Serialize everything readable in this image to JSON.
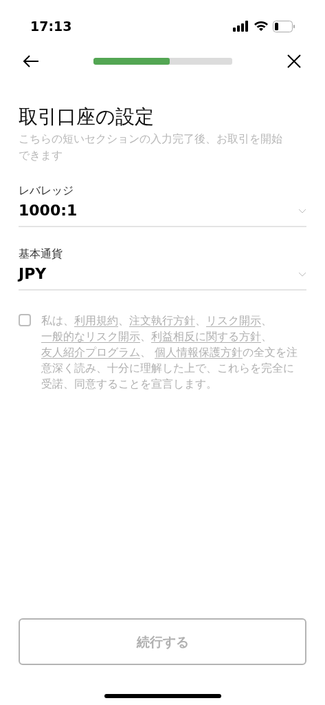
{
  "status_bar": {
    "time": "17:13"
  },
  "progress": {
    "level": 0.55
  },
  "title": "取引口座の設定",
  "subtitle": "こちらの短いセクションの入力完了後、お取引を開始できます",
  "fields": [
    {
      "label": "レバレッジ",
      "value": "1000:1"
    },
    {
      "label": "基本通貨",
      "value": "JPY"
    }
  ],
  "consent": {
    "checked": false,
    "parts": [
      {
        "text": "私は、",
        "link": false
      },
      {
        "text": "利用規約",
        "link": true
      },
      {
        "text": "、",
        "link": false
      },
      {
        "text": "注文執行方針",
        "link": true
      },
      {
        "text": "、",
        "link": false
      },
      {
        "text": "リスク開示",
        "link": true
      },
      {
        "text": "、",
        "link": false
      },
      {
        "text": "一般的なリスク開示",
        "link": true
      },
      {
        "text": "、",
        "link": false
      },
      {
        "text": "利益相反に関する方針",
        "link": true
      },
      {
        "text": "、",
        "link": false
      },
      {
        "text": "友人紹介プログラム",
        "link": true
      },
      {
        "text": "、 ",
        "link": false
      },
      {
        "text": "個人情報保護方針",
        "link": true
      },
      {
        "text": "の全文を注意深く読み、十分に理解した上で、これらを完全に受諾、同意することを宣言します。",
        "link": false
      }
    ]
  },
  "continue_button": {
    "label": "続行する",
    "disabled": true
  }
}
